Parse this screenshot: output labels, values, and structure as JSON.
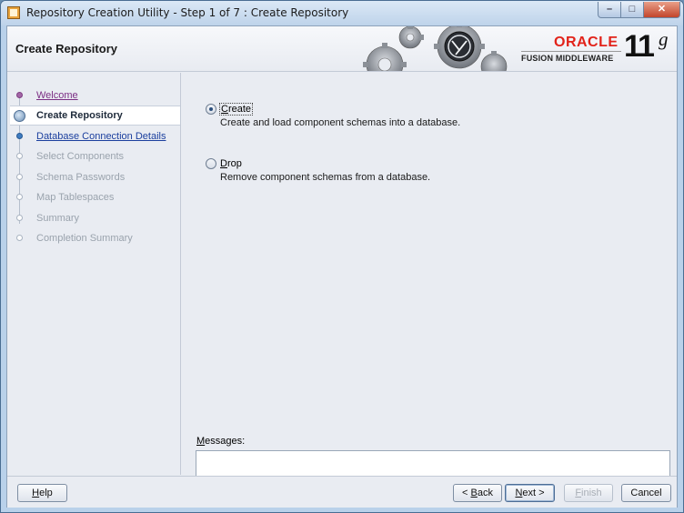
{
  "window": {
    "title": "Repository Creation Utility - Step 1 of 7 : Create Repository",
    "controls": {
      "minimize": "–",
      "maximize": "□",
      "close": "✕"
    }
  },
  "header": {
    "title": "Create Repository",
    "logo_oracle": "ORACLE",
    "logo_fusion": "FUSION MIDDLEWARE",
    "logo_version": "11",
    "logo_version_suffix": "g"
  },
  "nav": {
    "items": [
      {
        "label": "Welcome",
        "state": "done"
      },
      {
        "label": "Create Repository",
        "state": "current"
      },
      {
        "label": "Database Connection Details",
        "state": "next"
      },
      {
        "label": "Select Components",
        "state": "pending"
      },
      {
        "label": "Schema Passwords",
        "state": "pending"
      },
      {
        "label": "Map Tablespaces",
        "state": "pending"
      },
      {
        "label": "Summary",
        "state": "pending"
      },
      {
        "label": "Completion Summary",
        "state": "pending"
      }
    ]
  },
  "options": {
    "create": {
      "mnemonic": "C",
      "rest": "reate",
      "description": "Create and load component schemas into a database.",
      "selected": true
    },
    "drop": {
      "mnemonic": "D",
      "rest": "rop",
      "description": "Remove component schemas from a database.",
      "selected": false
    }
  },
  "messages": {
    "mnemonic": "M",
    "rest": "essages:",
    "content": ""
  },
  "buttons": {
    "help": {
      "mnemonic": "H",
      "rest": "elp"
    },
    "back": {
      "pre": "< ",
      "mnemonic": "B",
      "rest": "ack"
    },
    "next": {
      "mnemonic": "N",
      "rest": "ext >"
    },
    "finish": {
      "mnemonic": "F",
      "rest": "inish"
    },
    "cancel": {
      "label": "Cancel"
    }
  },
  "colors": {
    "oracle_red": "#e2231a",
    "nav_done": "#7b2e84",
    "nav_link": "#1b3f9e",
    "nav_pending": "#9aa3ad"
  }
}
